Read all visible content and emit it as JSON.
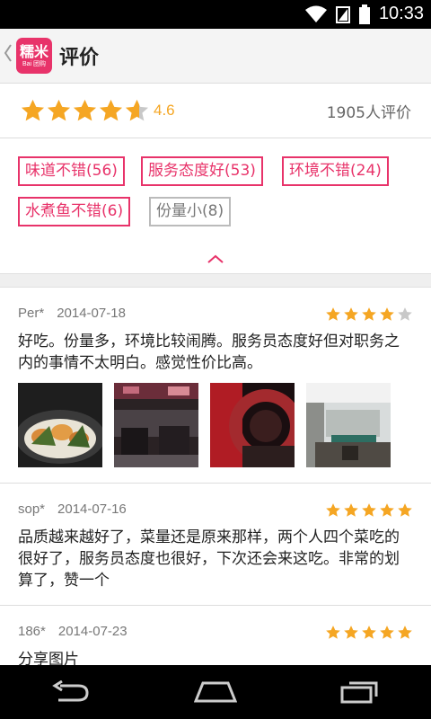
{
  "status": {
    "time": "10:33"
  },
  "header": {
    "logo_main": "糯米",
    "logo_sub": "Bai 团购",
    "title": "评价"
  },
  "summary": {
    "rating": 4.6,
    "score_label": "4.6",
    "count_label": "1905人评价"
  },
  "tags": [
    {
      "label": "味道不错(56)",
      "style": "highlight"
    },
    {
      "label": "服务态度好(53)",
      "style": "highlight"
    },
    {
      "label": "环境不错(24)",
      "style": "highlight"
    },
    {
      "label": "水煮鱼不错(6)",
      "style": "highlight"
    },
    {
      "label": "份量小(8)",
      "style": "neutral"
    }
  ],
  "reviews": [
    {
      "user": "Per*",
      "date": "2014-07-18",
      "stars": 4,
      "text": "好吃。份量多，环境比较闹腾。服务员态度好但对职务之内的事情不太明白。感觉性价比高。",
      "photo_count": 4
    },
    {
      "user": "sop*",
      "date": "2014-07-16",
      "stars": 5,
      "text": "品质越来越好了，菜量还是原来那样，两个人四个菜吃的很好了，服务员态度也很好，下次还会来这吃。非常的划算了，赞一个",
      "photo_count": 0
    },
    {
      "user": "186*",
      "date": "2014-07-23",
      "stars": 5,
      "text": "分享图片",
      "photo_count": 0
    }
  ],
  "colors": {
    "accent": "#e8336a",
    "star": "#f5a623",
    "star_empty": "#c8c8c8"
  }
}
